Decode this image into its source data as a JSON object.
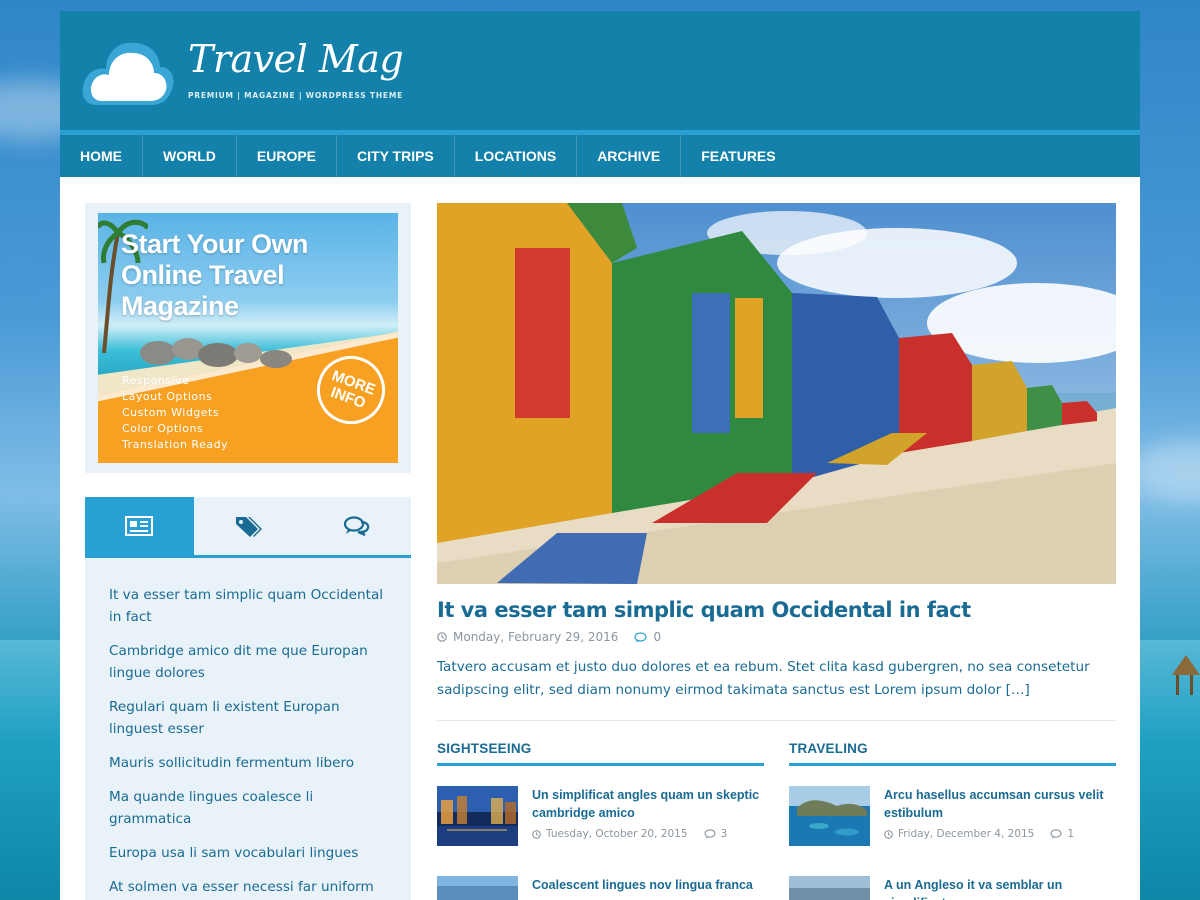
{
  "site": {
    "title": "Travel Mag",
    "tagline": "PREMIUM | MAGAZINE | WORDPRESS THEME"
  },
  "nav": {
    "items": [
      "HOME",
      "WORLD",
      "EUROPE",
      "CITY TRIPS",
      "LOCATIONS",
      "ARCHIVE",
      "FEATURES"
    ]
  },
  "ad": {
    "title_line1": "Start Your Own",
    "title_line2": "Online Travel",
    "title_line3": "Magazine",
    "features": [
      "Responsive",
      "Layout Options",
      "Custom Widgets",
      "Color Options",
      "Translation Ready"
    ],
    "more_line1": "MORE",
    "more_line2": "INFO"
  },
  "sidebar_tabs": {
    "icons": [
      "newspaper-icon",
      "tags-icon",
      "comments-icon"
    ],
    "active_index": 0,
    "posts": [
      "It va esser tam simplic quam Occidental in fact",
      "Cambridge amico dit me que Europan lingue dolores",
      "Regulari quam li existent Europan linguest esser",
      "Mauris sollicitudin fermentum libero",
      "Ma quande lingues coalesce li grammatica",
      "Europa usa li sam vocabulari lingues",
      "At solmen va esser necessi far uniform lingues"
    ]
  },
  "featured": {
    "title": "It va esser tam simplic quam Occidental in fact",
    "date": "Monday, February 29, 2016",
    "comments": "0",
    "excerpt": "Tatvero accusam et justo duo dolores et ea rebum. Stet clita kasd gubergren, no sea consetetur sadipscing elitr, sed diam nonumy eirmod takimata sanctus est Lorem ipsum dolor […]"
  },
  "categories": [
    {
      "name": "SIGHTSEEING",
      "posts": [
        {
          "title": "Un simplificat angles quam un skeptic cambridge amico",
          "date": "Tuesday, October 20, 2015",
          "comments": "3"
        },
        {
          "title": "Coalescent lingues nov lingua franca va",
          "date": "",
          "comments": ""
        }
      ]
    },
    {
      "name": "TRAVELING",
      "posts": [
        {
          "title": "Arcu hasellus accumsan cursus velit estibulum",
          "date": "Friday, December 4, 2015",
          "comments": "1"
        },
        {
          "title": "A un Angleso it va semblar un simplificat",
          "date": "",
          "comments": ""
        }
      ]
    }
  ],
  "colors": {
    "brand": "#1381a9",
    "accent": "#28a0d3",
    "link": "#1a6b93",
    "ad_orange": "#f7a021"
  }
}
